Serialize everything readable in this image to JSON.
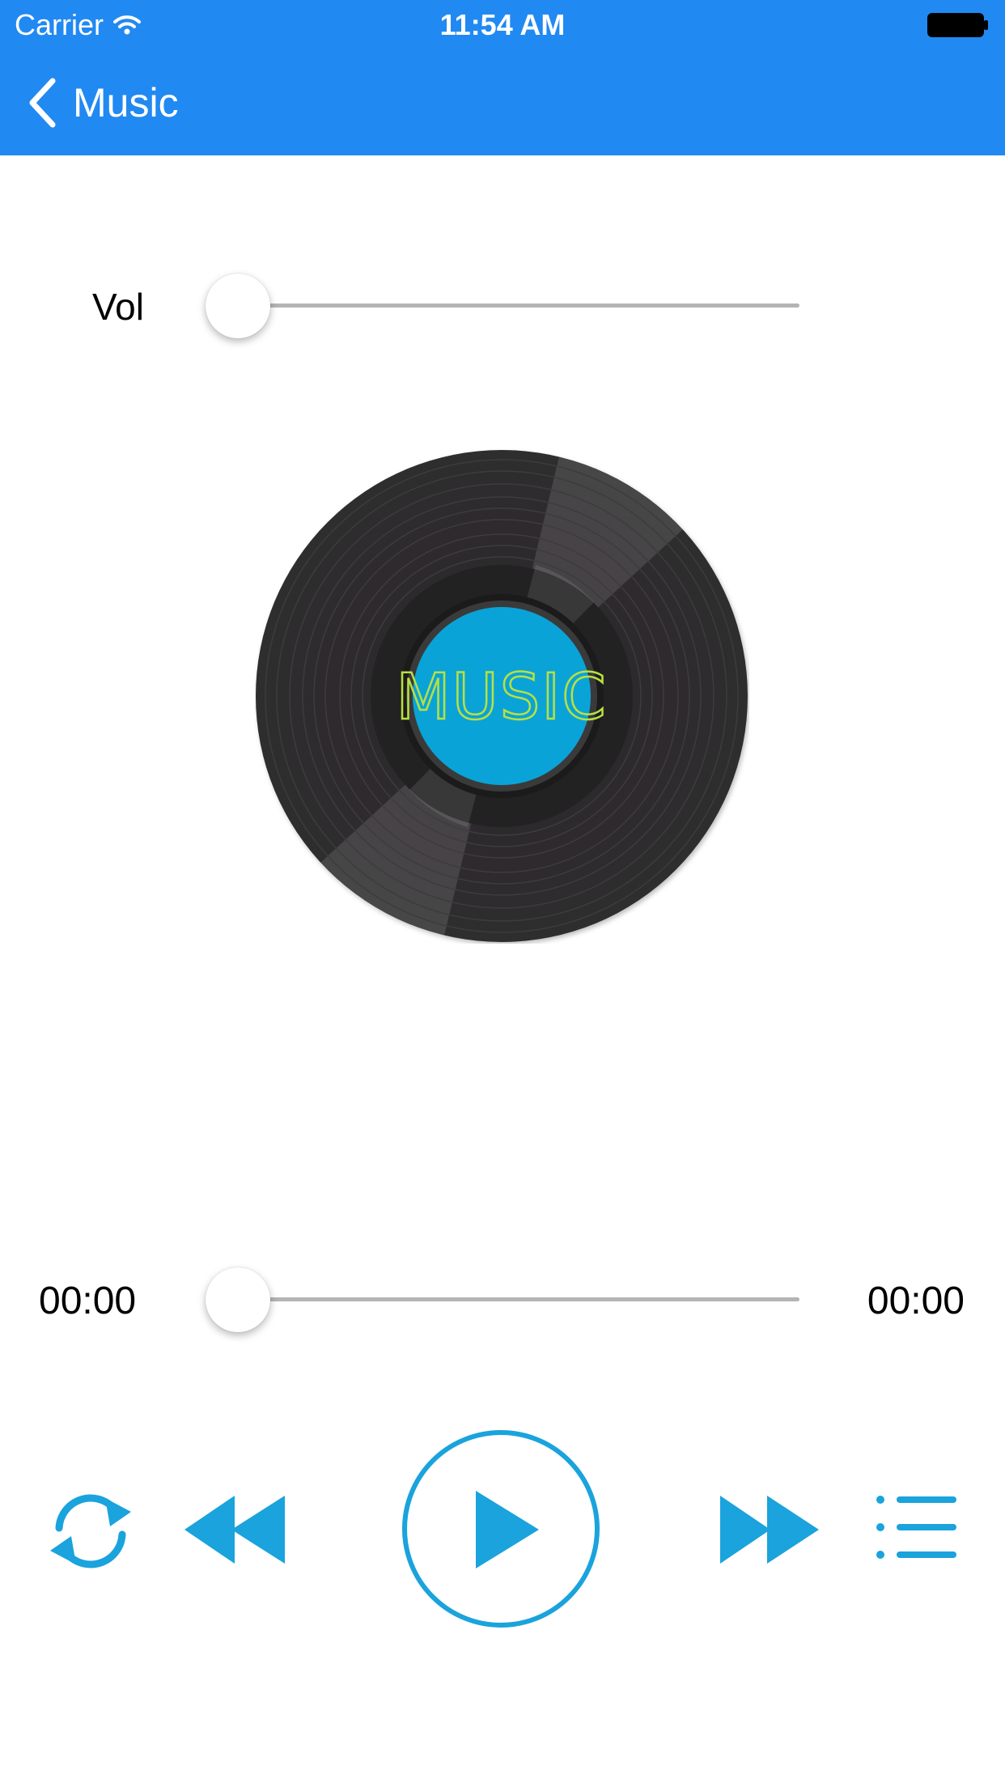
{
  "status_bar": {
    "carrier": "Carrier",
    "time": "11:54 AM"
  },
  "nav": {
    "back_label": "Music"
  },
  "volume": {
    "label": "Vol",
    "level": 0
  },
  "disc": {
    "label_text": "MUSIC"
  },
  "playback": {
    "current_time": "00:00",
    "total_time": "00:00",
    "progress": 0
  },
  "icons": {
    "back": "chevron-left-icon",
    "repeat": "repeat-icon",
    "rewind": "rewind-icon",
    "play": "play-icon",
    "forward": "fast-forward-icon",
    "list": "playlist-icon"
  },
  "colors": {
    "header": "#2189f2",
    "accent": "#1aa3dc",
    "disc_label": "#0aa3d8",
    "disc_text": "#b8e040"
  }
}
